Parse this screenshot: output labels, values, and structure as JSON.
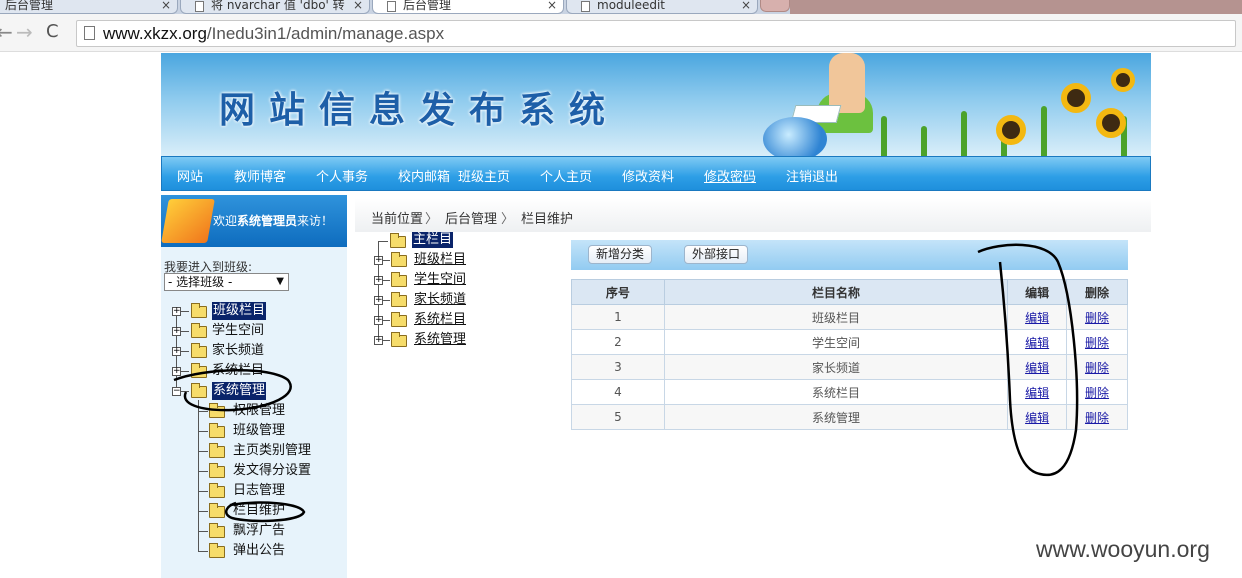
{
  "browser": {
    "tabs": [
      {
        "title": "后台管理"
      },
      {
        "title": "将 nvarchar 值 'dbo' 转"
      },
      {
        "title": "后台管理"
      },
      {
        "title": "moduleedit"
      }
    ],
    "close_glyph": "×",
    "url_host": "www.xkzx.org",
    "url_path": "/Inedu3in1/admin/manage.aspx",
    "back_glyph": "←",
    "forward_glyph": "→",
    "reload_glyph": "C"
  },
  "banner": {
    "title": "网站信息发布系统"
  },
  "menu": [
    "网站",
    "教师博客",
    "个人事务",
    "校内邮箱",
    "班级主页",
    "个人主页",
    "修改资料",
    "修改密码",
    "注销退出"
  ],
  "sidebar": {
    "welcome_pre": "欢迎",
    "welcome_user": "系统管理员",
    "welcome_post": "来访！",
    "class_label": "我要进入到班级:",
    "class_select_value": "- 选择班级 -",
    "tree": [
      "班级栏目",
      "学生空间",
      "家长频道",
      "系统栏目",
      "系统管理"
    ],
    "sub_items": [
      "权限管理",
      "班级管理",
      "主页类别管理",
      "发文得分设置",
      "日志管理",
      "栏目维护",
      "飘浮广告",
      "弹出公告"
    ]
  },
  "breadcrumb": {
    "items": [
      "当前位置",
      "后台管理",
      "栏目维护"
    ],
    "separator": "〉"
  },
  "content_tree": {
    "root": "主栏目",
    "children": [
      "班级栏目",
      "学生空间",
      "家长频道",
      "系统栏目",
      "系统管理"
    ]
  },
  "toolbar": {
    "add_category": "新增分类",
    "external_api": "外部接口"
  },
  "table": {
    "headers": [
      "序号",
      "栏目名称",
      "编辑",
      "删除"
    ],
    "rows": [
      {
        "no": "1",
        "name": "班级栏目",
        "edit": "编辑",
        "del": "删除"
      },
      {
        "no": "2",
        "name": "学生空间",
        "edit": "编辑",
        "del": "删除"
      },
      {
        "no": "3",
        "name": "家长频道",
        "edit": "编辑",
        "del": "删除"
      },
      {
        "no": "4",
        "name": "系统栏目",
        "edit": "编辑",
        "del": "删除"
      },
      {
        "no": "5",
        "name": "系统管理",
        "edit": "编辑",
        "del": "删除"
      }
    ]
  },
  "watermark": "www.wooyun.org",
  "colors": {
    "menu_blue": "#2d9ee6",
    "selection": "#0a246a",
    "link": "#1a1aa6"
  }
}
